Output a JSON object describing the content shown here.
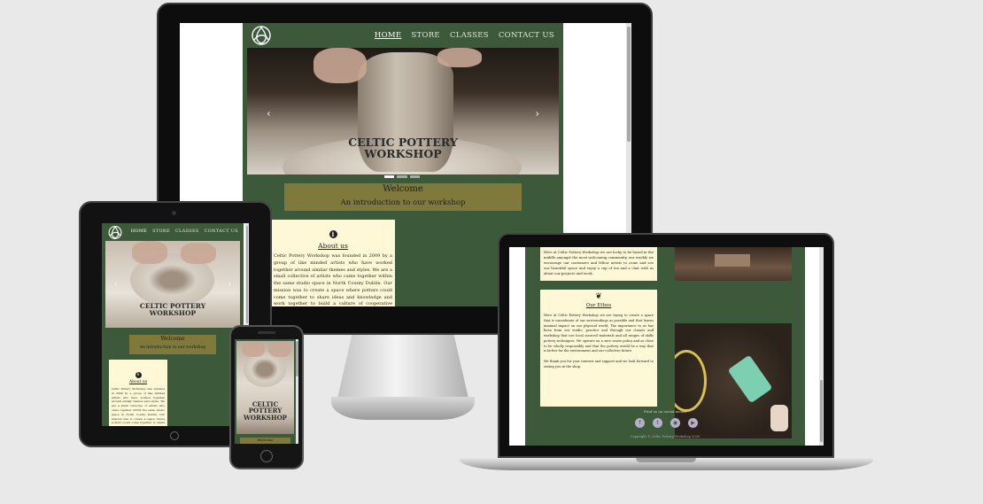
{
  "site": {
    "nav": [
      "HOME",
      "STORE",
      "CLASSES",
      "CONTACT US"
    ],
    "hero_title_line1": "CELTIC POTTERY",
    "hero_title_line2": "WORKSHOP",
    "welcome_title": "Welcome",
    "welcome_subtitle": "An introduction to our workshop",
    "about_heading": "About us",
    "about_text": "Celtic Pottery Workshop was founded in 2009 by a group of like minded artists who have worked together around similar themes and styles. We are a small collective of artists who came together within the same studio space in North County Dublin. Our mission was to create a space where potters could come together to share ideas and knowledge and work together to build a culture of cooperative pottery in Ireland. Our styles are varying but what joins our work is the",
    "ethos_heading": "Our Ethos",
    "ethos_text": "Here at Celtic Pottery Workshop we are trying to create a space that is considerate of our surroundings as possible and that leaves minimal impact on our physical world. The importance to us has been from our studio, practice and through our classes and workshop that use local sourced materials and all ranges of skills pottery techniques. We operate on a zero waste policy and as close to be wholly responsibly and that the pottery would be a way that is better for the environment and our collective future.",
    "ethos_text_2": "We thank you for your interest and support and we look forward to seeing you in the shop.",
    "laptop_top_text": "Here at Celtic Pottery Workshop we are lucky to be based in the middle amongst the most welcoming community, our weekly we encourage our customers and fellow artists to come and see our beautiful space and enjoy a cup of tea and a chat with us about our projects and work.",
    "footer_follow": "Find us on social media",
    "footer_copyright": "Copyright © Celtic Pottery Workshop 2020",
    "phone_partial_heading": "Welcome"
  },
  "social_icons": [
    "facebook-icon",
    "twitter-icon",
    "instagram-icon",
    "youtube-icon"
  ],
  "colors": {
    "brand_green": "#3c5a3a",
    "welcome_olive": "#7f7a3c",
    "card_cream": "#fff8d7"
  }
}
